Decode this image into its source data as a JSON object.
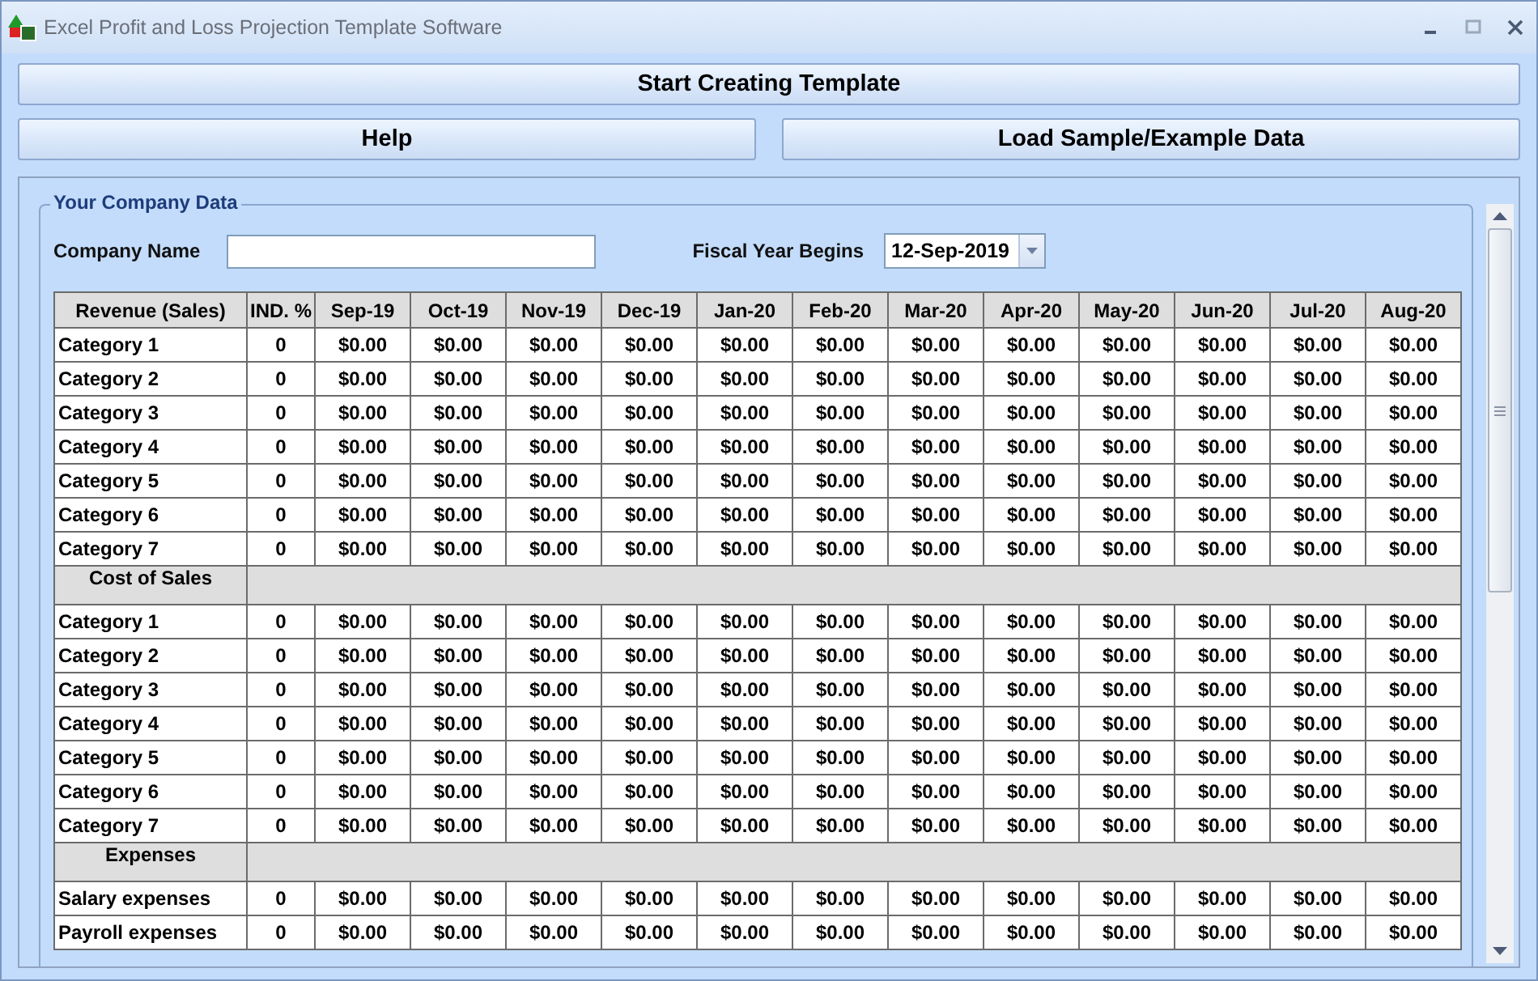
{
  "window": {
    "title": "Excel Profit and Loss Projection Template Software"
  },
  "buttons": {
    "start": "Start Creating Template",
    "help": "Help",
    "load": "Load Sample/Example Data"
  },
  "group": {
    "legend": "Your Company Data",
    "company_label": "Company Name",
    "fiscal_label": "Fiscal Year Begins",
    "fiscal_value": "12-Sep-2019"
  },
  "table": {
    "columns": [
      "Revenue (Sales)",
      "IND. %",
      "Sep-19",
      "Oct-19",
      "Nov-19",
      "Dec-19",
      "Jan-20",
      "Feb-20",
      "Mar-20",
      "Apr-20",
      "May-20",
      "Jun-20",
      "Jul-20",
      "Aug-20"
    ],
    "body": [
      {
        "kind": "row",
        "label": "Category 1",
        "ind": "0",
        "values": [
          "$0.00",
          "$0.00",
          "$0.00",
          "$0.00",
          "$0.00",
          "$0.00",
          "$0.00",
          "$0.00",
          "$0.00",
          "$0.00",
          "$0.00",
          "$0.00"
        ]
      },
      {
        "kind": "row",
        "label": "Category 2",
        "ind": "0",
        "values": [
          "$0.00",
          "$0.00",
          "$0.00",
          "$0.00",
          "$0.00",
          "$0.00",
          "$0.00",
          "$0.00",
          "$0.00",
          "$0.00",
          "$0.00",
          "$0.00"
        ]
      },
      {
        "kind": "row",
        "label": "Category 3",
        "ind": "0",
        "values": [
          "$0.00",
          "$0.00",
          "$0.00",
          "$0.00",
          "$0.00",
          "$0.00",
          "$0.00",
          "$0.00",
          "$0.00",
          "$0.00",
          "$0.00",
          "$0.00"
        ]
      },
      {
        "kind": "row",
        "label": "Category 4",
        "ind": "0",
        "values": [
          "$0.00",
          "$0.00",
          "$0.00",
          "$0.00",
          "$0.00",
          "$0.00",
          "$0.00",
          "$0.00",
          "$0.00",
          "$0.00",
          "$0.00",
          "$0.00"
        ]
      },
      {
        "kind": "row",
        "label": "Category 5",
        "ind": "0",
        "values": [
          "$0.00",
          "$0.00",
          "$0.00",
          "$0.00",
          "$0.00",
          "$0.00",
          "$0.00",
          "$0.00",
          "$0.00",
          "$0.00",
          "$0.00",
          "$0.00"
        ]
      },
      {
        "kind": "row",
        "label": "Category 6",
        "ind": "0",
        "values": [
          "$0.00",
          "$0.00",
          "$0.00",
          "$0.00",
          "$0.00",
          "$0.00",
          "$0.00",
          "$0.00",
          "$0.00",
          "$0.00",
          "$0.00",
          "$0.00"
        ]
      },
      {
        "kind": "row",
        "label": "Category 7",
        "ind": "0",
        "values": [
          "$0.00",
          "$0.00",
          "$0.00",
          "$0.00",
          "$0.00",
          "$0.00",
          "$0.00",
          "$0.00",
          "$0.00",
          "$0.00",
          "$0.00",
          "$0.00"
        ]
      },
      {
        "kind": "section",
        "label": "Cost of Sales"
      },
      {
        "kind": "row",
        "label": "Category 1",
        "ind": "0",
        "values": [
          "$0.00",
          "$0.00",
          "$0.00",
          "$0.00",
          "$0.00",
          "$0.00",
          "$0.00",
          "$0.00",
          "$0.00",
          "$0.00",
          "$0.00",
          "$0.00"
        ]
      },
      {
        "kind": "row",
        "label": "Category 2",
        "ind": "0",
        "values": [
          "$0.00",
          "$0.00",
          "$0.00",
          "$0.00",
          "$0.00",
          "$0.00",
          "$0.00",
          "$0.00",
          "$0.00",
          "$0.00",
          "$0.00",
          "$0.00"
        ]
      },
      {
        "kind": "row",
        "label": "Category 3",
        "ind": "0",
        "values": [
          "$0.00",
          "$0.00",
          "$0.00",
          "$0.00",
          "$0.00",
          "$0.00",
          "$0.00",
          "$0.00",
          "$0.00",
          "$0.00",
          "$0.00",
          "$0.00"
        ]
      },
      {
        "kind": "row",
        "label": "Category 4",
        "ind": "0",
        "values": [
          "$0.00",
          "$0.00",
          "$0.00",
          "$0.00",
          "$0.00",
          "$0.00",
          "$0.00",
          "$0.00",
          "$0.00",
          "$0.00",
          "$0.00",
          "$0.00"
        ]
      },
      {
        "kind": "row",
        "label": "Category 5",
        "ind": "0",
        "values": [
          "$0.00",
          "$0.00",
          "$0.00",
          "$0.00",
          "$0.00",
          "$0.00",
          "$0.00",
          "$0.00",
          "$0.00",
          "$0.00",
          "$0.00",
          "$0.00"
        ]
      },
      {
        "kind": "row",
        "label": "Category 6",
        "ind": "0",
        "values": [
          "$0.00",
          "$0.00",
          "$0.00",
          "$0.00",
          "$0.00",
          "$0.00",
          "$0.00",
          "$0.00",
          "$0.00",
          "$0.00",
          "$0.00",
          "$0.00"
        ]
      },
      {
        "kind": "row",
        "label": "Category 7",
        "ind": "0",
        "values": [
          "$0.00",
          "$0.00",
          "$0.00",
          "$0.00",
          "$0.00",
          "$0.00",
          "$0.00",
          "$0.00",
          "$0.00",
          "$0.00",
          "$0.00",
          "$0.00"
        ]
      },
      {
        "kind": "section",
        "label": "Expenses"
      },
      {
        "kind": "row",
        "label": "Salary expenses",
        "ind": "0",
        "values": [
          "$0.00",
          "$0.00",
          "$0.00",
          "$0.00",
          "$0.00",
          "$0.00",
          "$0.00",
          "$0.00",
          "$0.00",
          "$0.00",
          "$0.00",
          "$0.00"
        ]
      },
      {
        "kind": "row",
        "label": "Payroll expenses",
        "ind": "0",
        "values": [
          "$0.00",
          "$0.00",
          "$0.00",
          "$0.00",
          "$0.00",
          "$0.00",
          "$0.00",
          "$0.00",
          "$0.00",
          "$0.00",
          "$0.00",
          "$0.00"
        ]
      }
    ]
  }
}
